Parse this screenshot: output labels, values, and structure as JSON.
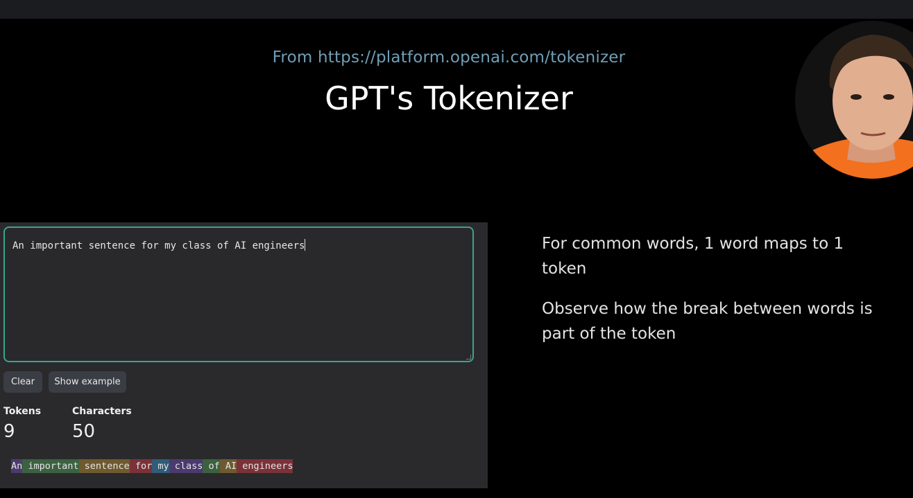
{
  "slide": {
    "source": "From https://platform.openai.com/tokenizer",
    "title": "GPT's Tokenizer"
  },
  "tokenizer": {
    "input_value": "An important sentence for my class of AI engineers",
    "buttons": {
      "clear": "Clear",
      "show_example": "Show example"
    },
    "stats": {
      "tokens_label": "Tokens",
      "tokens_value": "9",
      "characters_label": "Characters",
      "characters_value": "50"
    },
    "tokens": [
      {
        "text": "An",
        "color": "#4b3a6e"
      },
      {
        "text": " important",
        "color": "#3c6140"
      },
      {
        "text": " sentence",
        "color": "#6e5a2e"
      },
      {
        "text": " for",
        "color": "#7a3238"
      },
      {
        "text": " my",
        "color": "#2f5c78"
      },
      {
        "text": " class",
        "color": "#4b3a6e"
      },
      {
        "text": " of",
        "color": "#3c6140"
      },
      {
        "text": " AI",
        "color": "#6e5a2e"
      },
      {
        "text": " engineers",
        "color": "#7a3238"
      }
    ],
    "accent_border": "#3aa58a"
  },
  "notes": [
    "For common words, 1 word maps to 1 token",
    "Observe how the break between words is part of the token"
  ]
}
